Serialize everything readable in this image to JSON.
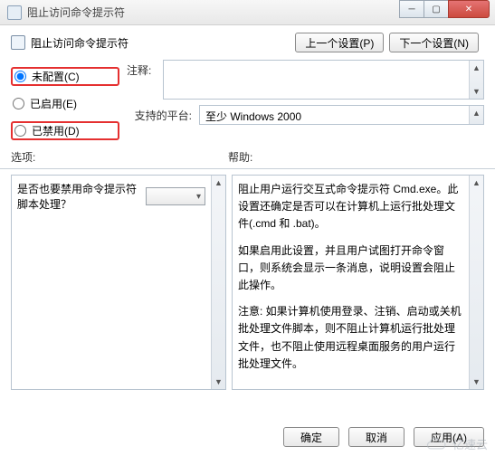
{
  "window": {
    "title": "阻止访问命令提示符"
  },
  "header": {
    "title": "阻止访问命令提示符",
    "prev_label": "上一个设置(P)",
    "next_label": "下一个设置(N)"
  },
  "radios": {
    "not_configured": "未配置(C)",
    "enabled": "已启用(E)",
    "disabled": "已禁用(D)"
  },
  "labels": {
    "notes": "注释:",
    "platform": "支持的平台:",
    "options": "选项:",
    "help": "帮助:"
  },
  "platform_text": "至少 Windows 2000",
  "option_question": "是否也要禁用命令提示符脚本处理？",
  "help": {
    "p1": "阻止用户运行交互式命令提示符 Cmd.exe。此设置还确定是否可以在计算机上运行批处理文件(.cmd 和 .bat)。",
    "p2": "如果启用此设置，并且用户试图打开命令窗口，则系统会显示一条消息，说明设置会阻止此操作。",
    "p3": "注意: 如果计算机使用登录、注销、启动或关机批处理文件脚本，则不阻止计算机运行批处理文件，也不阻止使用远程桌面服务的用户运行批处理文件。"
  },
  "footer": {
    "ok": "确定",
    "cancel": "取消",
    "apply": "应用(A)"
  },
  "watermark": "亿速云"
}
